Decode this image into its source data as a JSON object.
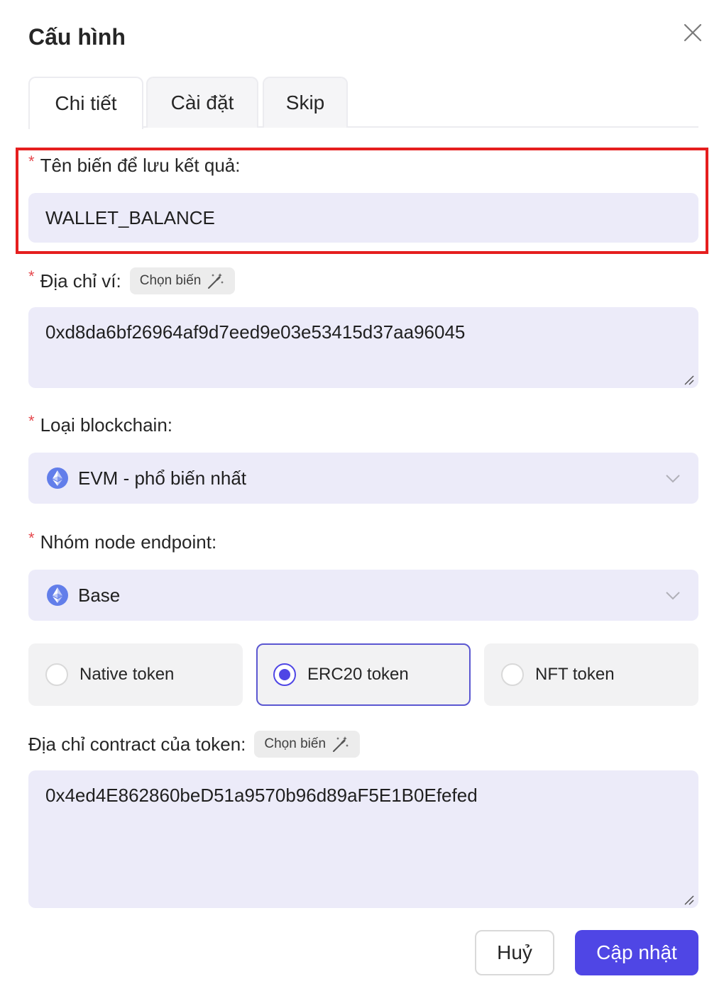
{
  "dialog": {
    "title": "Cấu hình"
  },
  "tabs": [
    {
      "label": "Chi tiết",
      "active": true
    },
    {
      "label": "Cài đặt",
      "active": false
    },
    {
      "label": "Skip",
      "active": false
    }
  ],
  "fields": {
    "result_var": {
      "label": "Tên biến để lưu kết quả:",
      "value": "WALLET_BALANCE"
    },
    "wallet_address": {
      "label": "Địa chỉ ví:",
      "chip": "Chọn biến",
      "value": "0xd8da6bf26964af9d7eed9e03e53415d37aa96045"
    },
    "blockchain": {
      "label": "Loại blockchain:",
      "value": "EVM - phổ biến nhất"
    },
    "node_group": {
      "label": "Nhóm node endpoint:",
      "value": "Base"
    },
    "token_contract": {
      "label": "Địa chỉ contract của token:",
      "chip": "Chọn biến",
      "value": "0x4ed4E862860beD51a9570b96d89aF5E1B0Efefed"
    }
  },
  "token_types": [
    {
      "label": "Native token",
      "selected": false
    },
    {
      "label": "ERC20 token",
      "selected": true
    },
    {
      "label": "NFT token",
      "selected": false
    }
  ],
  "footer": {
    "cancel": "Huỷ",
    "update": "Cập nhật"
  },
  "colors": {
    "accent": "#4f46e5",
    "field_bg": "#ecebf9",
    "required": "#e5484d",
    "highlight": "#e51e1e"
  },
  "icons": {
    "close": "close-icon",
    "chip": "magic-wand-icon",
    "network": "ethereum-icon",
    "dropdown": "chevron-down-icon"
  }
}
